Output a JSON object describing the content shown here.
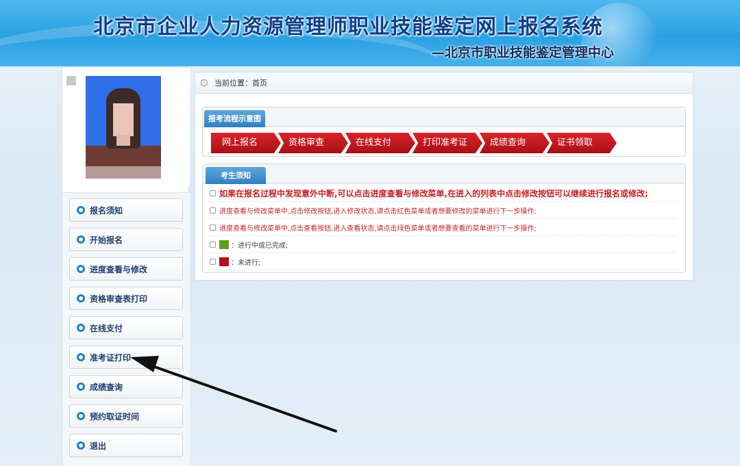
{
  "header": {
    "title": "北京市企业人力资源管理师职业技能鉴定网上报名系统",
    "subtitle": "—北京市职业技能鉴定管理中心"
  },
  "sidebar": {
    "menu": [
      {
        "label": "报名须知"
      },
      {
        "label": "开始报名"
      },
      {
        "label": "进度查看与修改"
      },
      {
        "label": "资格审查表打印"
      },
      {
        "label": "在线支付"
      },
      {
        "label": "准考证打印"
      },
      {
        "label": "成绩查询"
      },
      {
        "label": "预约取证时间"
      },
      {
        "label": "退出"
      }
    ]
  },
  "breadcrumb": {
    "label": "当前位置：首页"
  },
  "flow": {
    "title": "报考流程示意图",
    "steps": [
      {
        "label": "网上报名"
      },
      {
        "label": "资格审查"
      },
      {
        "label": "在线支付"
      },
      {
        "label": "打印准考证"
      },
      {
        "label": "成绩查询"
      },
      {
        "label": "证书领取"
      }
    ]
  },
  "notice": {
    "title": "考生须知",
    "items": [
      {
        "text": "如果在报名过程中发现意外中断,可以点击进度查看与修改菜单,在进入的列表中点击修改按钮可以继续进行报名或修改;"
      },
      {
        "text": "进度查看与修改菜单中,点击修改按钮,进入修改状态,请点击红色菜单或者想要修改的菜单进行下一步操作;"
      },
      {
        "text": "进度查看与修改菜单中,点击查看按钮,进入查看状态,请点击绿色菜单或者想要查看的菜单进行下一步操作;"
      },
      {
        "text": "：进行中或已完成;",
        "swatch_color": "#5e9e1c"
      },
      {
        "text": "：未进行;",
        "swatch_color": "#b71017"
      }
    ]
  },
  "colors": {
    "header_blue": "#2aa0e3",
    "step_red": "#c41a20",
    "tab_blue": "#3f8fcf"
  }
}
